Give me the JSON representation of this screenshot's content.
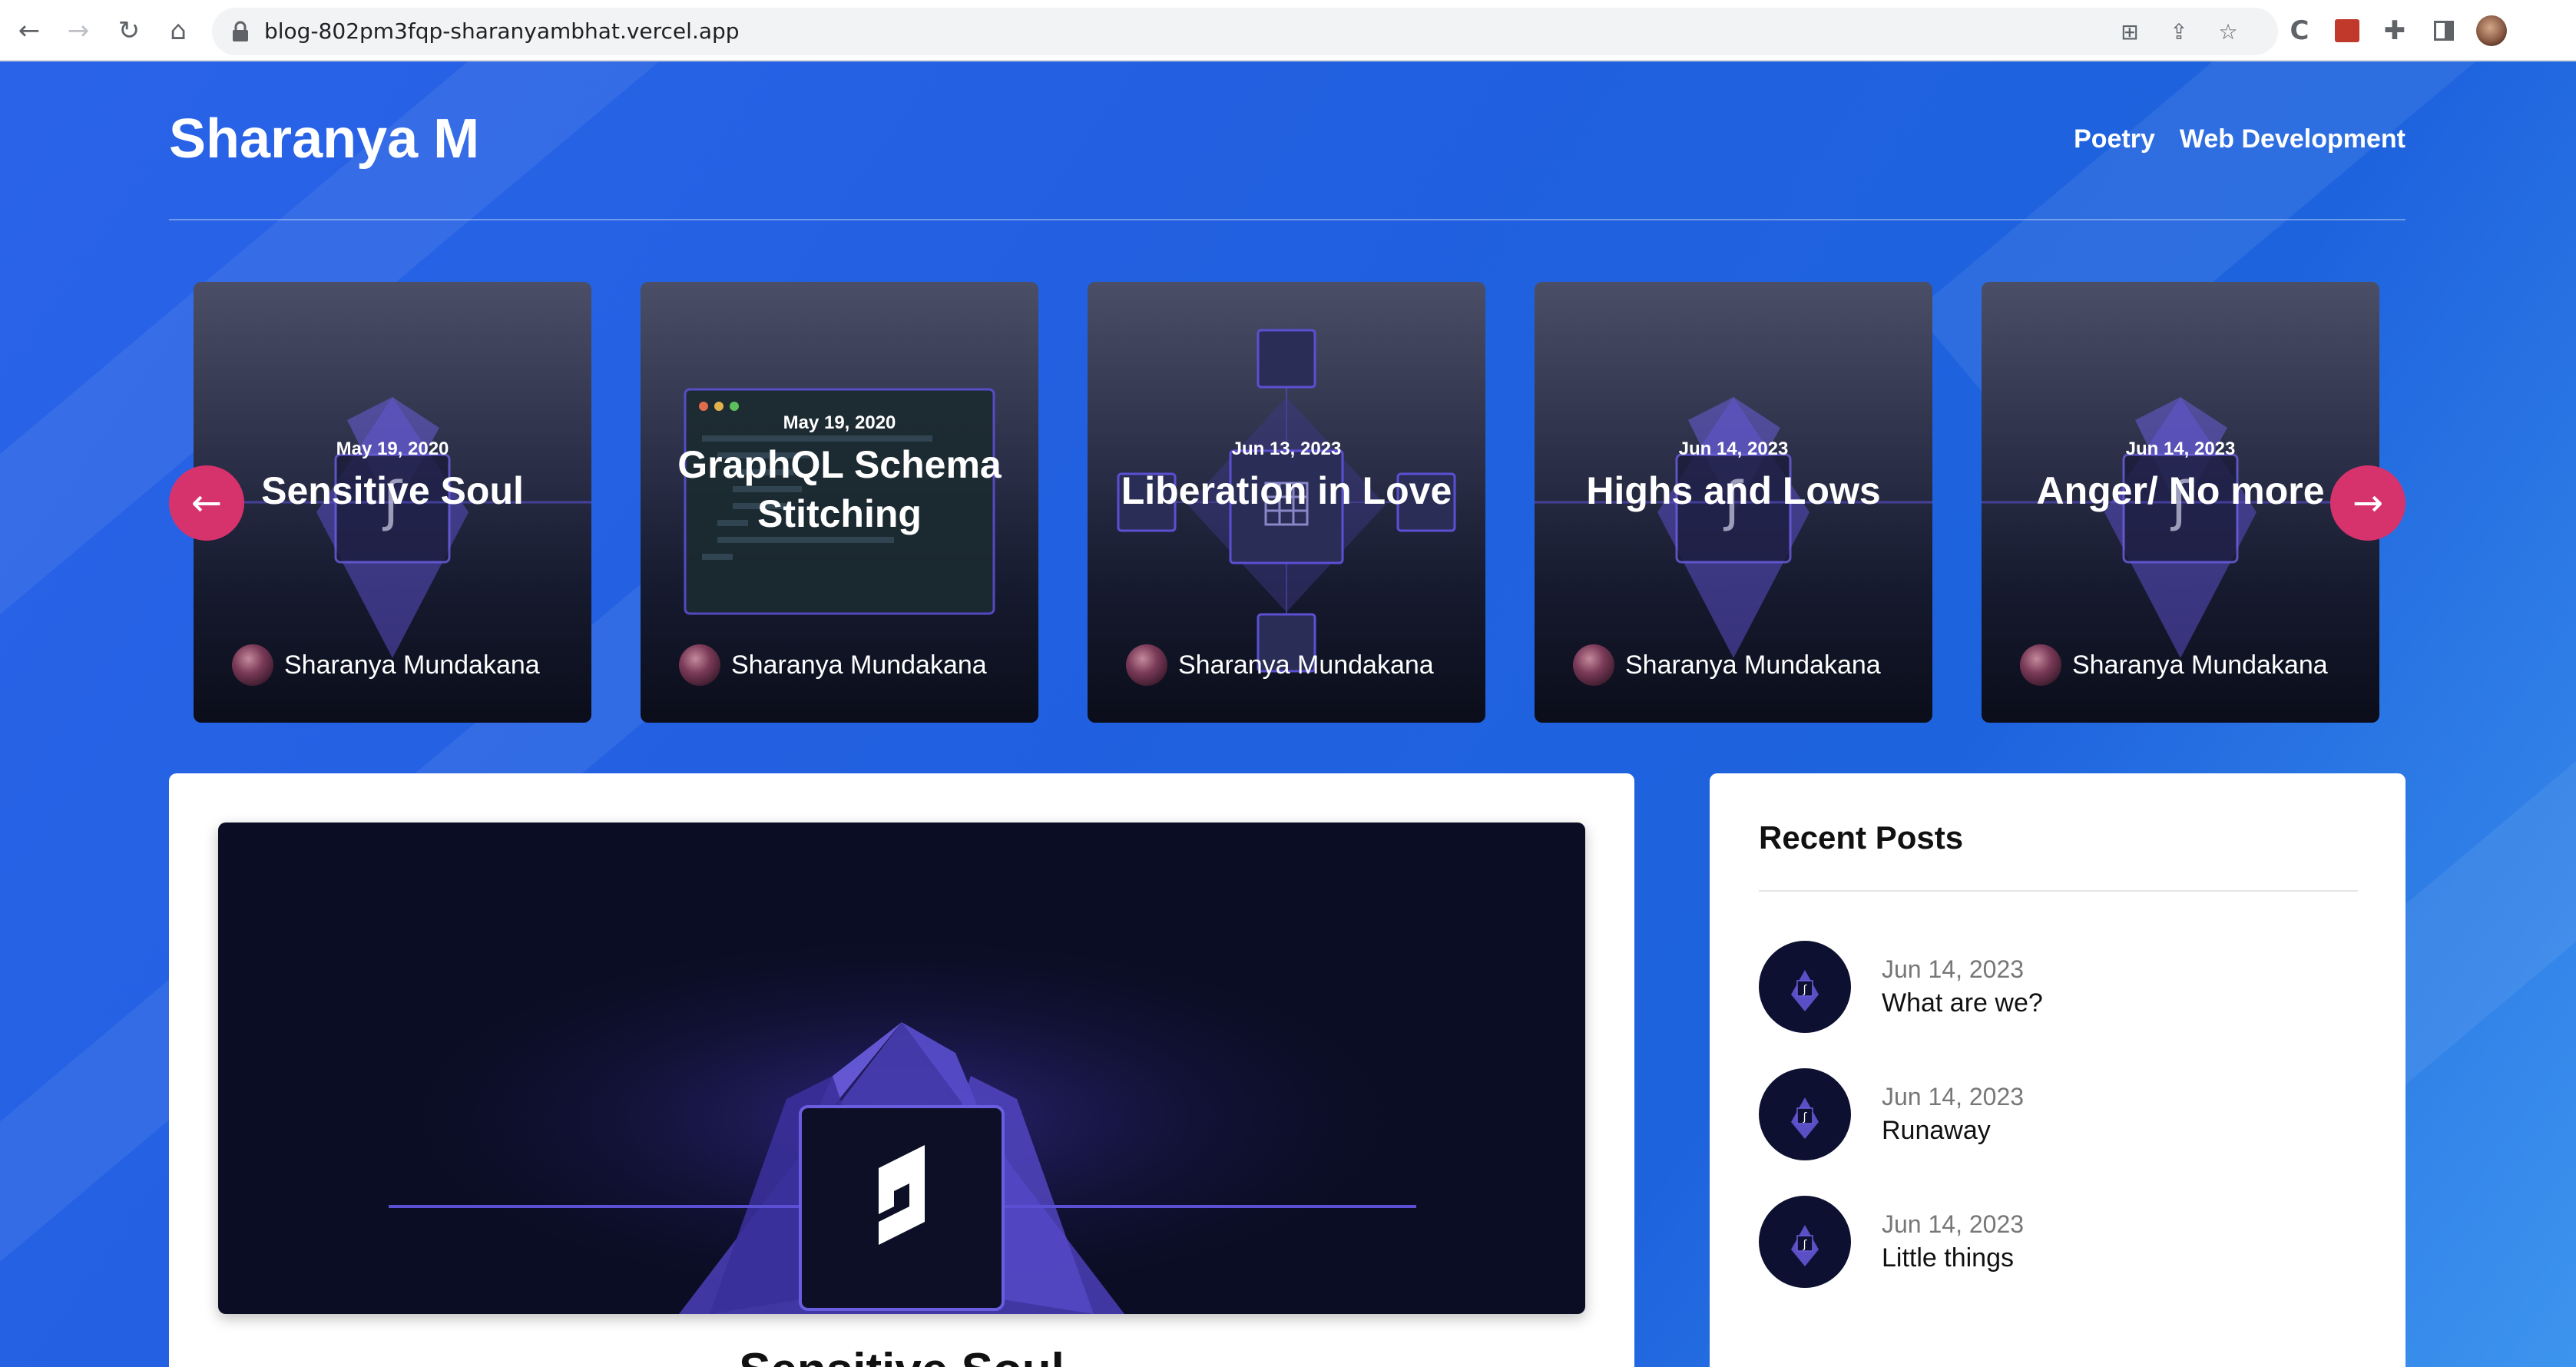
{
  "browser": {
    "url": "blog-802pm3fqp-sharanyambhat.vercel.app"
  },
  "site": {
    "title": "Sharanya M",
    "nav": [
      {
        "label": "Poetry"
      },
      {
        "label": "Web Development"
      }
    ]
  },
  "carousel": {
    "cards": [
      {
        "date": "May 19, 2020",
        "title": "Sensitive Soul",
        "author": "Sharanya Mundakana"
      },
      {
        "date": "May 19, 2020",
        "title": "GraphQL Schema Stitching",
        "author": "Sharanya Mundakana"
      },
      {
        "date": "Jun 13, 2023",
        "title": "Liberation in Love",
        "author": "Sharanya Mundakana"
      },
      {
        "date": "Jun 14, 2023",
        "title": "Highs and Lows",
        "author": "Sharanya Mundakana"
      },
      {
        "date": "Jun 14, 2023",
        "title": "Anger/ No more",
        "author": "Sharanya Mundakana"
      }
    ]
  },
  "main_post": {
    "title": "Sensitive Soul"
  },
  "sidebar": {
    "heading": "Recent Posts",
    "posts": [
      {
        "date": "Jun 14, 2023",
        "title": "What are we?"
      },
      {
        "date": "Jun 14, 2023",
        "title": "Runaway"
      },
      {
        "date": "Jun 14, 2023",
        "title": "Little things"
      }
    ]
  },
  "colors": {
    "accent": "#d6336c",
    "background": "#2160e0"
  }
}
